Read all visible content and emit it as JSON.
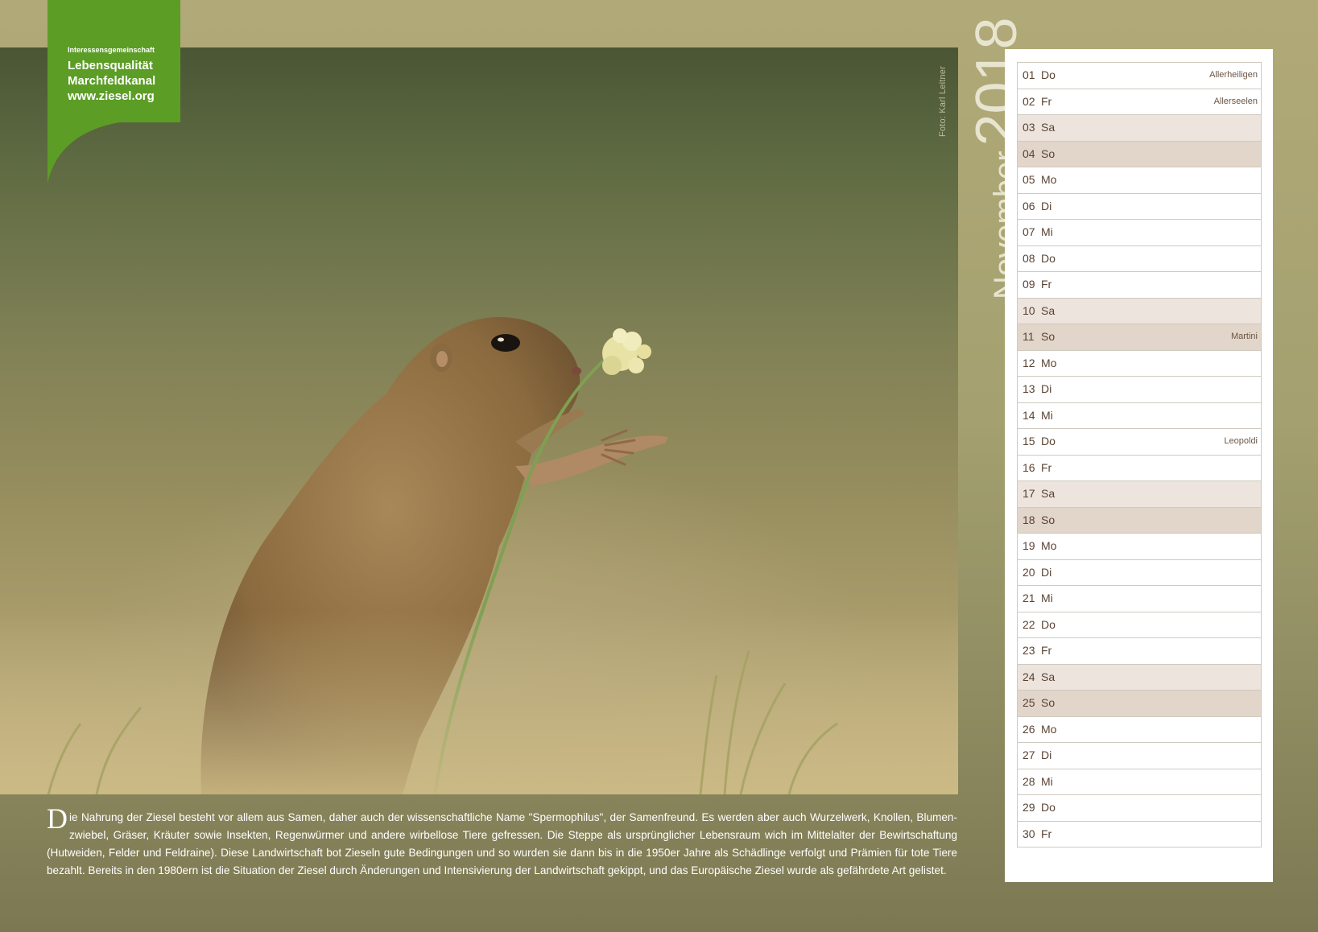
{
  "logo": {
    "line1": "Interessensgemeinschaft",
    "line2": "Lebensqualität",
    "line3": "Marchfeldkanal",
    "line4": "www.ziesel.org",
    "color": "#5c9d26"
  },
  "photo_credit": "Foto: Karl Leitner",
  "header": {
    "month": "November",
    "year": "2018"
  },
  "calendar": [
    {
      "day": "01",
      "weekday": "Do",
      "holiday": "Allerheiligen",
      "type": "weekday"
    },
    {
      "day": "02",
      "weekday": "Fr",
      "holiday": "Allerseelen",
      "type": "weekday"
    },
    {
      "day": "03",
      "weekday": "Sa",
      "holiday": "",
      "type": "sat"
    },
    {
      "day": "04",
      "weekday": "So",
      "holiday": "",
      "type": "sun"
    },
    {
      "day": "05",
      "weekday": "Mo",
      "holiday": "",
      "type": "weekday"
    },
    {
      "day": "06",
      "weekday": "Di",
      "holiday": "",
      "type": "weekday"
    },
    {
      "day": "07",
      "weekday": "Mi",
      "holiday": "",
      "type": "weekday"
    },
    {
      "day": "08",
      "weekday": "Do",
      "holiday": "",
      "type": "weekday"
    },
    {
      "day": "09",
      "weekday": "Fr",
      "holiday": "",
      "type": "weekday"
    },
    {
      "day": "10",
      "weekday": "Sa",
      "holiday": "",
      "type": "sat"
    },
    {
      "day": "11",
      "weekday": "So",
      "holiday": "Martini",
      "type": "sun"
    },
    {
      "day": "12",
      "weekday": "Mo",
      "holiday": "",
      "type": "weekday"
    },
    {
      "day": "13",
      "weekday": "Di",
      "holiday": "",
      "type": "weekday"
    },
    {
      "day": "14",
      "weekday": "Mi",
      "holiday": "",
      "type": "weekday"
    },
    {
      "day": "15",
      "weekday": "Do",
      "holiday": "Leopoldi",
      "type": "weekday"
    },
    {
      "day": "16",
      "weekday": "Fr",
      "holiday": "",
      "type": "weekday"
    },
    {
      "day": "17",
      "weekday": "Sa",
      "holiday": "",
      "type": "sat"
    },
    {
      "day": "18",
      "weekday": "So",
      "holiday": "",
      "type": "sun"
    },
    {
      "day": "19",
      "weekday": "Mo",
      "holiday": "",
      "type": "weekday"
    },
    {
      "day": "20",
      "weekday": "Di",
      "holiday": "",
      "type": "weekday"
    },
    {
      "day": "21",
      "weekday": "Mi",
      "holiday": "",
      "type": "weekday"
    },
    {
      "day": "22",
      "weekday": "Do",
      "holiday": "",
      "type": "weekday"
    },
    {
      "day": "23",
      "weekday": "Fr",
      "holiday": "",
      "type": "weekday"
    },
    {
      "day": "24",
      "weekday": "Sa",
      "holiday": "",
      "type": "sat"
    },
    {
      "day": "25",
      "weekday": "So",
      "holiday": "",
      "type": "sun"
    },
    {
      "day": "26",
      "weekday": "Mo",
      "holiday": "",
      "type": "weekday"
    },
    {
      "day": "27",
      "weekday": "Di",
      "holiday": "",
      "type": "weekday"
    },
    {
      "day": "28",
      "weekday": "Mi",
      "holiday": "",
      "type": "weekday"
    },
    {
      "day": "29",
      "weekday": "Do",
      "holiday": "",
      "type": "weekday"
    },
    {
      "day": "30",
      "weekday": "Fr",
      "holiday": "",
      "type": "weekday"
    }
  ],
  "description": {
    "dropcap": "D",
    "text": "ie Nahrung der Ziesel besteht vor allem aus Samen, daher auch der wissenschaftliche Name \"Spermophilus\", der Samenfreund. Es werden aber auch Wurzelwerk, Knollen, Blumen-zwiebel, Gräser, Kräuter sowie Insekten, Regenwürmer und andere wirbellose Tiere gefressen. Die Steppe als ursprünglicher Lebensraum wich im Mittelalter der Bewirtschaftung (Hutweiden, Felder und Feldraine). Diese Landwirtschaft bot Zieseln gute Bedingungen und so wurden sie dann bis in die 1950er Jahre als Schädlinge verfolgt und Prämien für tote Tiere bezahlt. Bereits in den 1980ern ist die Situation der Ziesel durch Änderungen und Intensivierung der Landwirtschaft gekippt, und das Europäische Ziesel wurde als gefährdete Art gelistet."
  }
}
